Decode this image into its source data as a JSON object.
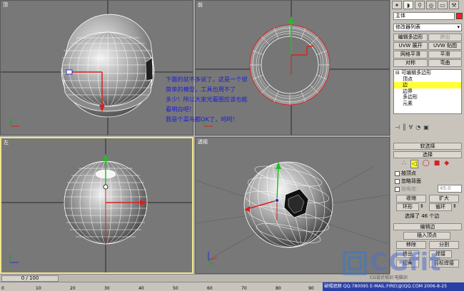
{
  "viewports": {
    "top": {
      "label": "顶"
    },
    "front": {
      "label": "前"
    },
    "left": {
      "label": "左"
    },
    "perspective": {
      "label": "透视"
    }
  },
  "annotation": {
    "lines": [
      "下面的就不多说了，这是一个很",
      "简单的模型，工具也用不了",
      "多少！所以大家光看图应该也能",
      "看明白吧！",
      "我是个菜鸟都OK了，呵呵！"
    ]
  },
  "command_panel": {
    "tab_icons": [
      "create-icon",
      "modify-icon",
      "hierarchy-icon",
      "motion-icon",
      "display-icon",
      "utilities-icon"
    ],
    "object_name": "主体",
    "object_color": "#ff2020",
    "modifier_list_label": "修改器列表",
    "modifier_buttons": [
      [
        "编辑多边形",
        "挤出"
      ],
      [
        "UVW 展开",
        "UVW 贴图"
      ],
      [
        "网格平滑",
        "平滑"
      ],
      [
        "对称",
        "弯曲"
      ]
    ],
    "modifier_stack": {
      "root": "可编辑多边形",
      "items": [
        "顶点",
        "边",
        "边界",
        "多边形",
        "元素"
      ],
      "selected": "边"
    },
    "soft_selection_rollout": "软选择",
    "selection_rollout": "选择",
    "by_vertex": "按顶点",
    "ignore_backfacing": "忽略背面",
    "by_angle": "按角度：",
    "angle_value": "45.0",
    "shrink": "收缩",
    "grow": "扩大",
    "ring": "环形",
    "loop": "循环",
    "selection_status": "选择了 46 个边",
    "edit_edges_rollout": "编辑边",
    "insert_vertex": "插入顶点",
    "remove": "移除",
    "split": "分割",
    "extrude": "挤出",
    "weld": "焊接",
    "chamfer": "切角",
    "target_weld": "目标焊接"
  },
  "timeline": {
    "slider": "0 / 100",
    "ticks": [
      "0",
      "10",
      "20",
      "30",
      "40",
      "50",
      "60",
      "70",
      "80",
      "90",
      "100"
    ]
  },
  "footer": {
    "text": "破帽遮颜 QQ:780095 E-MAIL:FIRE(@)QQ.COM 2006-8-25"
  },
  "watermark": {
    "brand": "CGfit",
    "sub": "CG设计培训 电脑训"
  }
}
